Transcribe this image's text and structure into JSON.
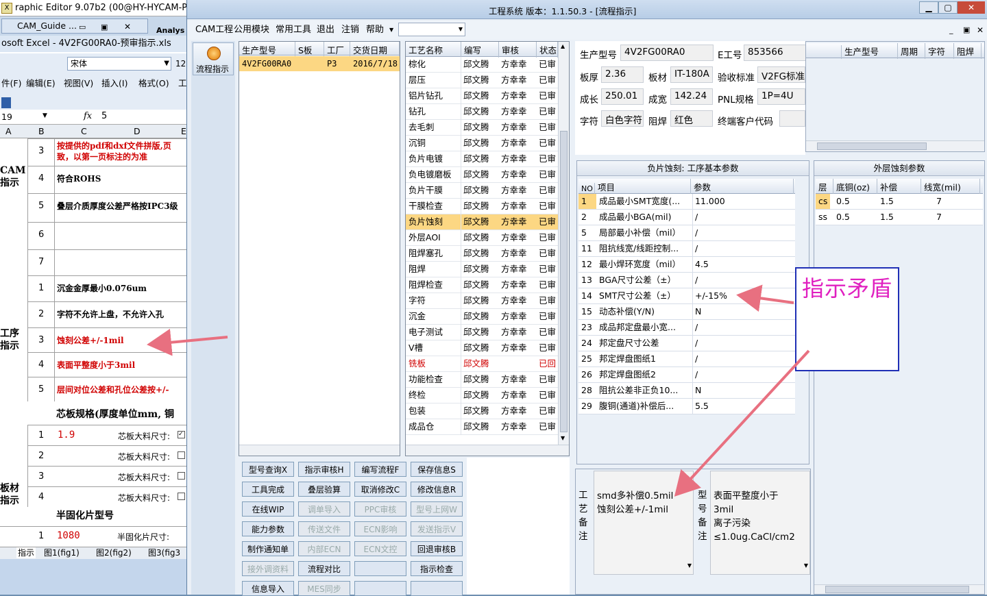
{
  "colors": {
    "accent_orange": "#f0a020",
    "annotation_magenta": "#e020c0",
    "arrow_pink": "#e87080",
    "red_text": "#d00000",
    "selected_row": "#fcd783"
  },
  "excel": {
    "graphic_editor_title": "raphic Editor 9.07b2 (00@HY-HYCAM-PC",
    "cam_guide_tab": "CAM_Guide ...",
    "analysis_partial": "Analys",
    "excel_title": "osoft Excel - 4V2FG00RA0-预审指示.xls",
    "font_name": "宋体",
    "font_size": "12",
    "menus": [
      "件(F)",
      "编辑(E)",
      "视图(V)",
      "插入(I)",
      "格式(O)",
      "工"
    ],
    "name_box": "19",
    "fx_label": "fx",
    "formula_value": "5",
    "col_headers": [
      "A",
      "B",
      "C",
      "D",
      "E"
    ],
    "section_cam": "CAM\n指示",
    "section_process": "工序\n指示",
    "section_board": "板材\n指示",
    "rows": [
      {
        "num": "3",
        "text": "按提供的pdf和dxf文件拼版,页\n致，以第一页标注的为准",
        "red": true
      },
      {
        "num": "4",
        "text": "符合ROHS",
        "red": false
      },
      {
        "num": "5",
        "text": "叠层介质厚度公差严格按IPC3级",
        "red": false
      },
      {
        "num": "6",
        "text": "",
        "red": false
      },
      {
        "num": "7",
        "text": "",
        "red": false
      },
      {
        "num": "1",
        "text": "沉金金厚最小0.076um",
        "red": false
      },
      {
        "num": "2",
        "text": "字符不允许上盘，不允许入孔",
        "red": false
      },
      {
        "num": "3",
        "text": "蚀刻公差+/-1mil",
        "red": true
      },
      {
        "num": "4",
        "text": "表面平整度小于3mil",
        "red": true
      },
      {
        "num": "5",
        "text": "层间对位公差和孔位公差按+/-",
        "red": true
      }
    ],
    "core_title": "芯板规格(厚度单位mm, 铜",
    "core_rows": [
      {
        "num": "1",
        "val": "1.9",
        "label": "芯板大料尺寸:"
      },
      {
        "num": "2",
        "val": "",
        "label": "芯板大料尺寸:"
      },
      {
        "num": "3",
        "val": "",
        "label": "芯板大料尺寸:"
      },
      {
        "num": "4",
        "val": "",
        "label": "芯板大料尺寸:"
      }
    ],
    "prepreg_title": "半固化片型号",
    "prepreg_row": {
      "num": "1",
      "val": "1080",
      "label": "半固化片尺寸:"
    },
    "sheet_tabs": [
      "指示",
      "图1(fig1)",
      "图2(fig2)",
      "图3(fig3"
    ]
  },
  "app": {
    "title": "工程系统   版本：1.1.50.3 - [流程指示]",
    "menus": [
      "CAM工程",
      "公用模块",
      "常用工具",
      "退出",
      "注销",
      "帮助"
    ],
    "side_button": "流程指示",
    "left_grid": {
      "headers": [
        "生产型号",
        "S板",
        "工厂",
        "交货日期"
      ],
      "row": [
        "4V2FG00RA0",
        "",
        "P3",
        "2016/7/18"
      ]
    },
    "process_grid": {
      "headers": [
        "工艺名称",
        "编写",
        "审核",
        "状态"
      ],
      "rows": [
        [
          "棕化",
          "邱文腾",
          "方幸幸",
          "已审"
        ],
        [
          "层压",
          "邱文腾",
          "方幸幸",
          "已审"
        ],
        [
          "铝片钻孔",
          "邱文腾",
          "方幸幸",
          "已审"
        ],
        [
          "钻孔",
          "邱文腾",
          "方幸幸",
          "已审"
        ],
        [
          "去毛刺",
          "邱文腾",
          "方幸幸",
          "已审"
        ],
        [
          "沉铜",
          "邱文腾",
          "方幸幸",
          "已审"
        ],
        [
          "负片电镀",
          "邱文腾",
          "方幸幸",
          "已审"
        ],
        [
          "负电镀磨板",
          "邱文腾",
          "方幸幸",
          "已审"
        ],
        [
          "负片干膜",
          "邱文腾",
          "方幸幸",
          "已审"
        ],
        [
          "干膜检查",
          "邱文腾",
          "方幸幸",
          "已审"
        ],
        [
          "负片蚀刻",
          "邱文腾",
          "方幸幸",
          "已审"
        ],
        [
          "外层AOI",
          "邱文腾",
          "方幸幸",
          "已审"
        ],
        [
          "阻焊塞孔",
          "邱文腾",
          "方幸幸",
          "已审"
        ],
        [
          "阻焊",
          "邱文腾",
          "方幸幸",
          "已审"
        ],
        [
          "阻焊检查",
          "邱文腾",
          "方幸幸",
          "已审"
        ],
        [
          "字符",
          "邱文腾",
          "方幸幸",
          "已审"
        ],
        [
          "沉金",
          "邱文腾",
          "方幸幸",
          "已审"
        ],
        [
          "电子测试",
          "邱文腾",
          "方幸幸",
          "已审"
        ],
        [
          "V槽",
          "邱文腾",
          "方幸幸",
          "已审"
        ],
        [
          "铣板",
          "邱文腾",
          "",
          "已回"
        ],
        [
          "功能检查",
          "邱文腾",
          "方幸幸",
          "已审"
        ],
        [
          "终检",
          "邱文腾",
          "方幸幸",
          "已审"
        ],
        [
          "包装",
          "邱文腾",
          "方幸幸",
          "已审"
        ],
        [
          "成品仓",
          "邱文腾",
          "方幸幸",
          "已审"
        ]
      ],
      "selected_index": 10,
      "red_index": 19
    },
    "buttons": [
      {
        "label": "型号查询X",
        "disabled": false
      },
      {
        "label": "指示审核H",
        "disabled": false
      },
      {
        "label": "编写流程F",
        "disabled": false
      },
      {
        "label": "保存信息S",
        "disabled": false
      },
      {
        "label": "工具完成",
        "disabled": false
      },
      {
        "label": "叠层验算",
        "disabled": false
      },
      {
        "label": "取消修改C",
        "disabled": false
      },
      {
        "label": "修改信息R",
        "disabled": false
      },
      {
        "label": "在线WIP",
        "disabled": false
      },
      {
        "label": "调单导入",
        "disabled": true
      },
      {
        "label": "PPC审核",
        "disabled": true
      },
      {
        "label": "型号上网W",
        "disabled": true
      },
      {
        "label": "能力参数",
        "disabled": false
      },
      {
        "label": "传送文件",
        "disabled": true
      },
      {
        "label": "ECN影响",
        "disabled": true
      },
      {
        "label": "发送指示V",
        "disabled": true
      },
      {
        "label": "制作通知单",
        "disabled": false
      },
      {
        "label": "内部ECN",
        "disabled": true
      },
      {
        "label": "ECN文控",
        "disabled": true
      },
      {
        "label": "回退审核B",
        "disabled": false
      },
      {
        "label": "接外调资料",
        "disabled": true
      },
      {
        "label": "流程对比",
        "disabled": false
      },
      {
        "label": "",
        "disabled": false
      },
      {
        "label": "指示检查",
        "disabled": false
      },
      {
        "label": "信息导入",
        "disabled": false
      },
      {
        "label": "MES同步",
        "disabled": true
      },
      {
        "label": "",
        "disabled": false
      },
      {
        "label": "",
        "disabled": false
      }
    ],
    "info": {
      "model_label": "生产型号",
      "model": "4V2FG00RA0",
      "e_label": "E工号",
      "e_no": "853566",
      "thick_label": "板厚",
      "thick": "2.36",
      "mat_label": "板材",
      "mat": "IT-180A",
      "std_label": "验收标准",
      "std": "V2FG标准",
      "len_label": "成长",
      "len": "250.01",
      "wid_label": "成宽",
      "wid": "142.24",
      "pnl_label": "PNL规格",
      "pnl": "1P=4U",
      "char_label": "字符",
      "char": "白色字符",
      "mask_label": "阻焊",
      "mask": "红色",
      "cust_label": "终端客户代码",
      "cust": ""
    },
    "right_mini_headers": [
      "生产型号",
      "周期",
      "字符",
      "阻焊"
    ],
    "param_panel": {
      "title": "负片蚀刻: 工序基本参数",
      "headers": [
        "NO",
        "项目",
        "参数"
      ],
      "rows": [
        [
          "1",
          "成品最小SMT宽度(...",
          "11.000"
        ],
        [
          "2",
          "成品最小BGA(mil)",
          "/"
        ],
        [
          "5",
          "局部最小补偿（mil）",
          "/"
        ],
        [
          "11",
          "阻抗线宽/线距控制...",
          "/"
        ],
        [
          "12",
          "最小焊环宽度（mil）",
          "4.5"
        ],
        [
          "13",
          "BGA尺寸公差（±）",
          "/"
        ],
        [
          "14",
          "SMT尺寸公差（±）",
          "+/-15%"
        ],
        [
          "15",
          "动态补偿(Y/N)",
          "N"
        ],
        [
          "23",
          "成品邦定盘最小宽...",
          "/"
        ],
        [
          "24",
          "邦定盘尺寸公差",
          "/"
        ],
        [
          "25",
          "邦定焊盘图纸1",
          "/"
        ],
        [
          "26",
          "邦定焊盘图纸2",
          "/"
        ],
        [
          "28",
          "阻抗公差非正负10...",
          "N"
        ],
        [
          "29",
          "腹铜(通道)补偿后...",
          "5.5"
        ]
      ],
      "selected_index": 0
    },
    "etch_panel": {
      "title": "外层蚀刻参数",
      "headers": [
        "层",
        "底铜(oz)",
        "补偿",
        "线宽(mil)"
      ],
      "rows": [
        [
          "cs",
          "0.5",
          "1.5",
          "7"
        ],
        [
          "ss",
          "0.5",
          "1.5",
          "7"
        ]
      ]
    },
    "process_note_label": "工艺备注",
    "process_note": "smd多补偿0.5mil\n蚀刻公差+/-1mil",
    "model_note_label": "型号备注",
    "model_note": "表面平整度小于\n3mil\n离子污染\n≤1.0ug.CaCl/cm2"
  },
  "annotation": {
    "text": "指示矛盾"
  }
}
